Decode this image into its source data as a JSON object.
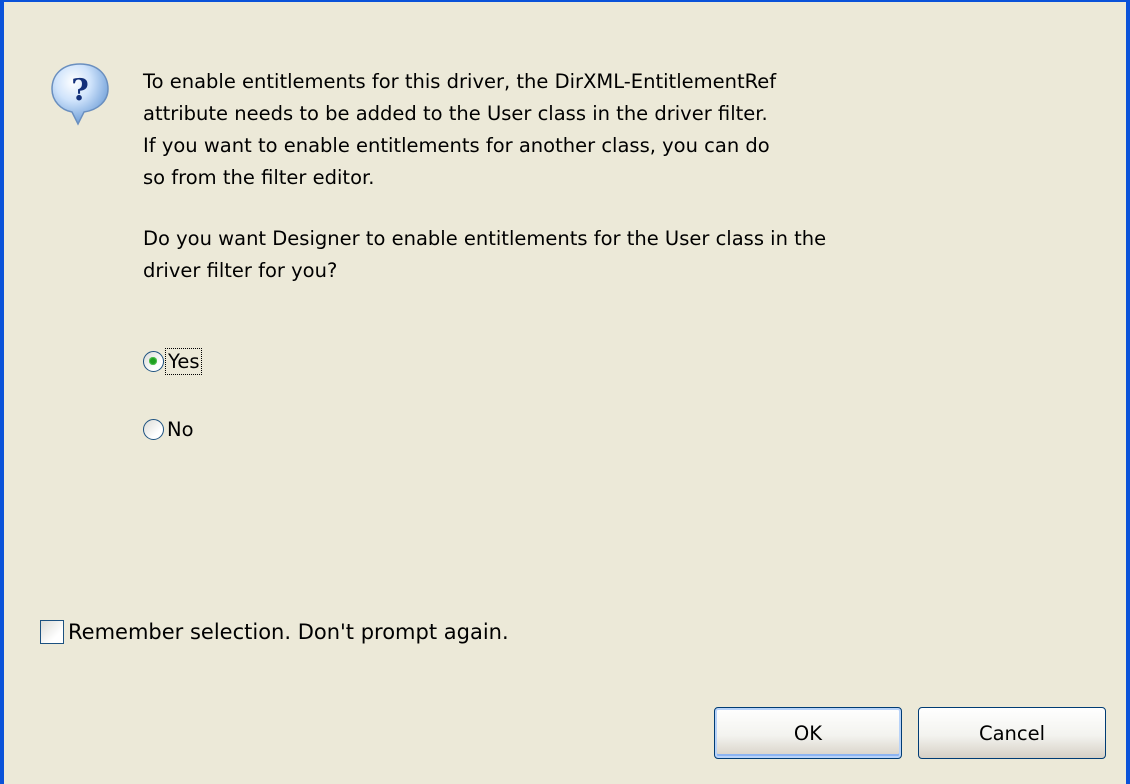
{
  "message": {
    "line1": "To enable entitlements for this driver, the DirXML-EntitlementRef",
    "line2": "attribute needs to be added to the User class in the driver filter.",
    "line3": "If you want to enable entitlements for another class, you can do",
    "line4": "so from the filter editor.",
    "question_line1": "Do you want Designer to enable entitlements for the User class in the",
    "question_line2": "driver filter for you?"
  },
  "options": {
    "yes_label": "Yes",
    "no_label": "No",
    "selected": "Yes"
  },
  "remember": {
    "label": "Remember selection. Don't prompt again.",
    "checked": false
  },
  "buttons": {
    "ok_label": "OK",
    "cancel_label": "Cancel"
  },
  "icon": "question-icon",
  "colors": {
    "window_border": "#0a52d9",
    "background": "#ece9d8",
    "radio_dot": "#21a121"
  }
}
